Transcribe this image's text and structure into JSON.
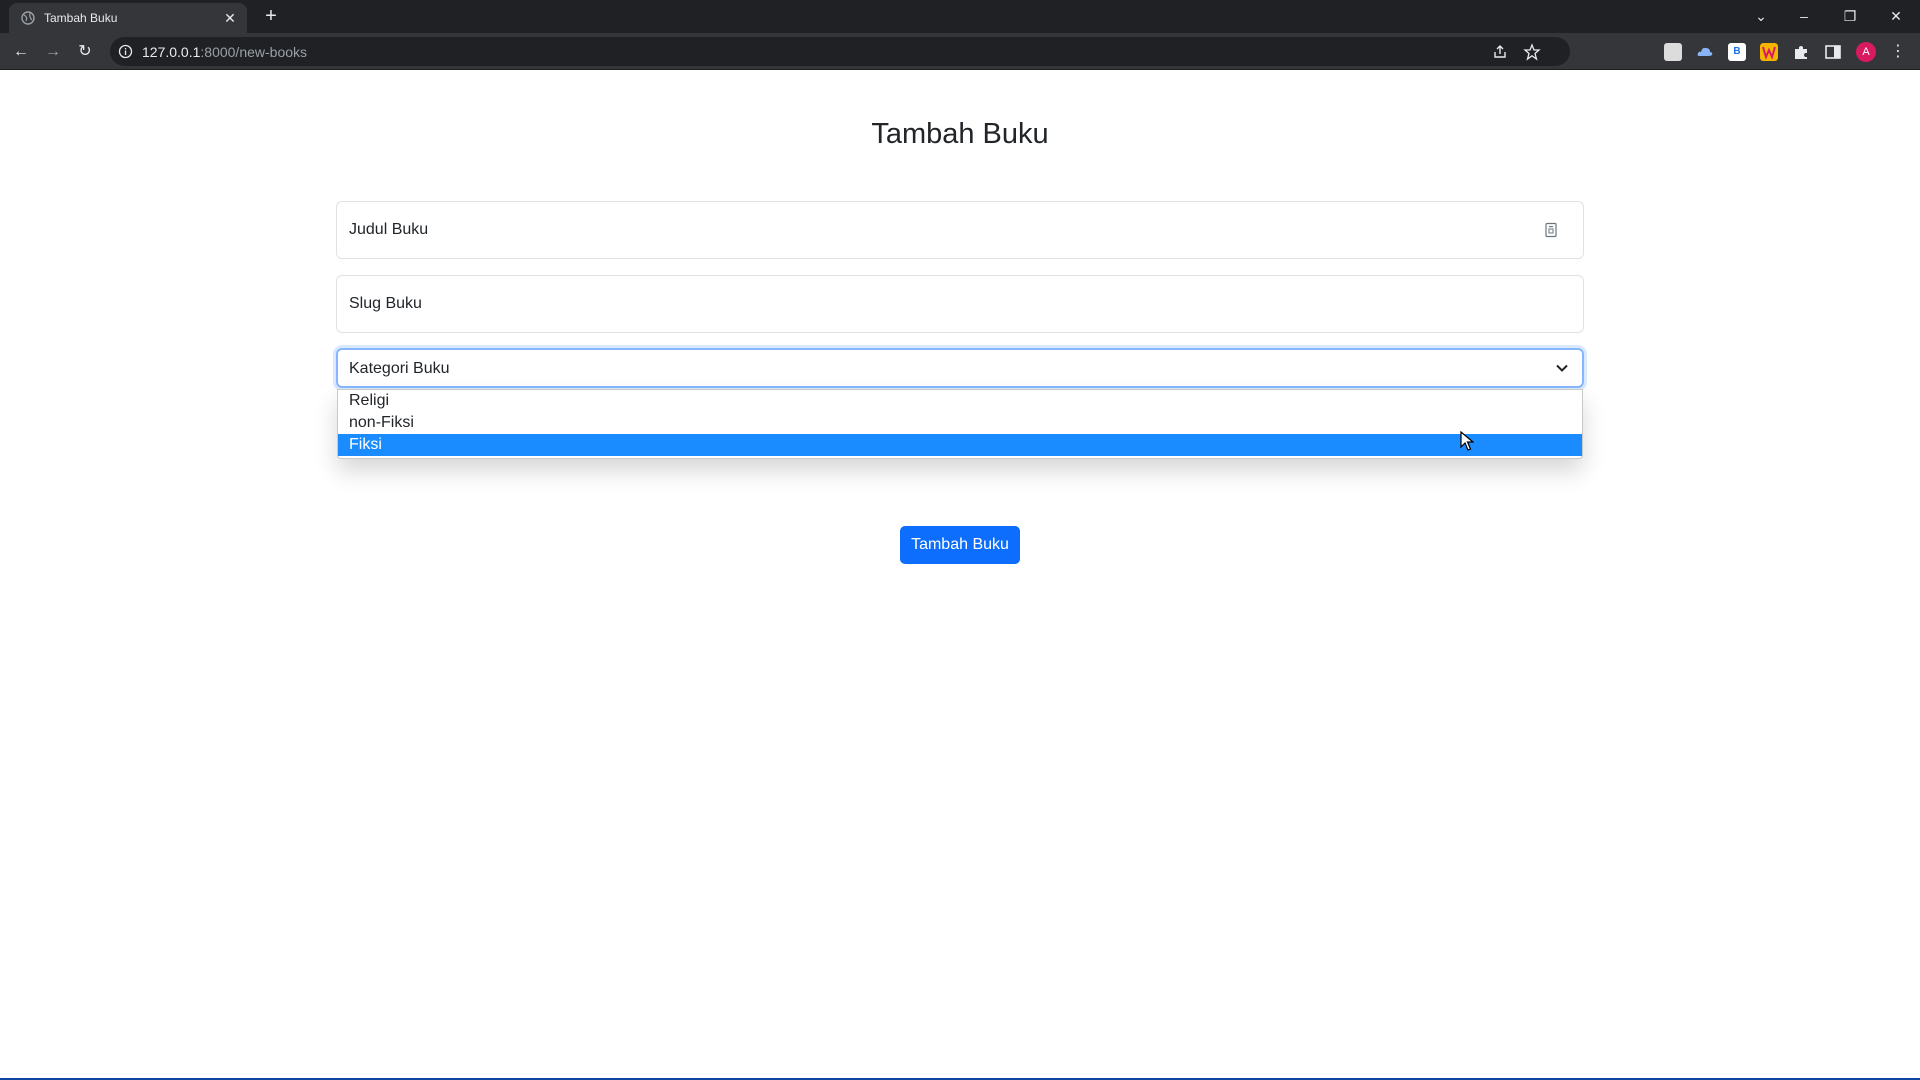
{
  "browser": {
    "tab_title": "Tambah Buku",
    "tab_close": "✕",
    "new_tab": "+",
    "url_host": "127.0.0.1",
    "url_rest": ":8000/new-books",
    "profile_initial": "A",
    "window_controls": {
      "minimize": "–",
      "restore": "❐",
      "close": "✕",
      "tab_search": "⌄"
    },
    "nav": {
      "back": "←",
      "forward": "→",
      "reload": "↻"
    },
    "menu": "⋮"
  },
  "page": {
    "title": "Tambah Buku",
    "form": {
      "title_field_placeholder": "Judul Buku",
      "slug_field_placeholder": "Slug Buku",
      "category_select_label": "Kategori Buku",
      "category_options": [
        "Religi",
        "non-Fiksi",
        "Fiksi"
      ],
      "highlighted_option": "Fiksi",
      "submit_label": "Tambah Buku"
    }
  },
  "colors": {
    "primary": "#0d6efd",
    "option_highlight": "#1a8cff",
    "focus_border": "#86b7fe",
    "chrome_dark": "#202124",
    "chrome_toolbar": "#35363a",
    "avatar": "#d81b60"
  }
}
